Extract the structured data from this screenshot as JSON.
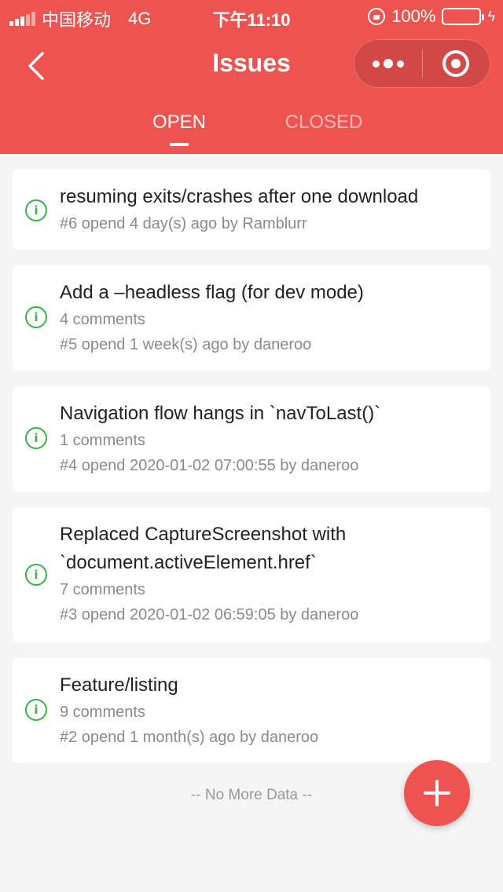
{
  "status_bar": {
    "carrier": "中国移动",
    "network": "4G",
    "time": "下午11:10",
    "battery": "100%"
  },
  "nav": {
    "title": "Issues"
  },
  "tabs": [
    {
      "label": "OPEN",
      "active": true
    },
    {
      "label": "CLOSED",
      "active": false
    }
  ],
  "issues": [
    {
      "title": "resuming exits/crashes after one download",
      "comments": "",
      "meta": "#6 opend 4 day(s) ago by Ramblurr"
    },
    {
      "title": "Add a –headless flag (for dev mode)",
      "comments": "4 comments",
      "meta": "#5 opend 1 week(s) ago by daneroo"
    },
    {
      "title": "Navigation flow hangs in `navToLast()`",
      "comments": "1 comments",
      "meta": "#4 opend 2020-01-02 07:00:55 by daneroo"
    },
    {
      "title_line1": "Replaced CaptureScreenshot with",
      "title_line2": "`document.activeElement.href`",
      "comments": "7 comments",
      "meta": "#3 opend 2020-01-02 06:59:05 by daneroo"
    },
    {
      "title": "Feature/listing",
      "comments": "9 comments",
      "meta": "#2 opend 1 month(s) ago by daneroo"
    }
  ],
  "issue_icon_glyph": "i",
  "footer": {
    "no_more": "-- No More Data --"
  },
  "colors": {
    "accent": "#ef5350",
    "open_icon": "#3bb04a"
  }
}
